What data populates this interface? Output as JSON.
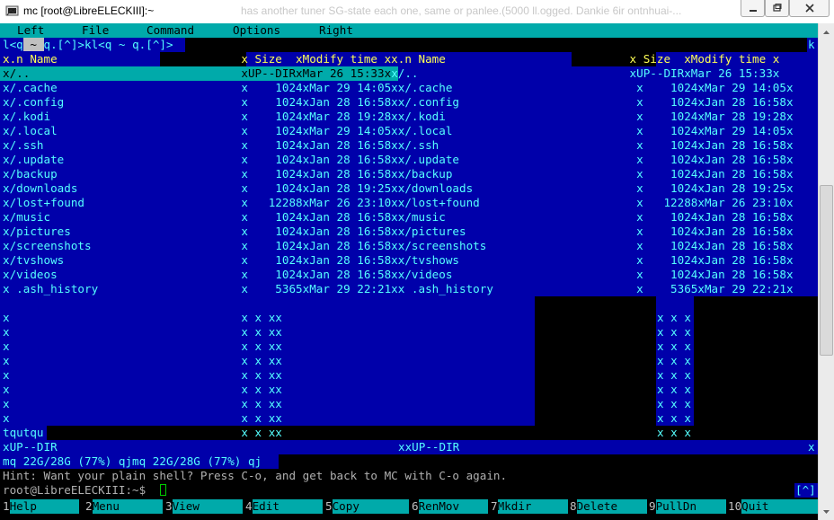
{
  "window": {
    "title": "mc [root@LibreELECKIII]:~",
    "ghost_text": "has another tuner SG-state each one, same or panlee.(5000 ll.ogged. Dankie 6ir ontnhuai-..."
  },
  "menubar": {
    "items": [
      {
        "label": "Left"
      },
      {
        "label": "File"
      },
      {
        "label": "Command"
      },
      {
        "label": "Options"
      },
      {
        "label": "Right"
      }
    ]
  },
  "line1": {
    "prefix": "l<q",
    "tilde": " ~ ",
    "rest": "q.[^]>kl<q ~ q.[^]>",
    "right_k": "k"
  },
  "header": {
    "left": "x.n Name                           x Size  xModify time xx",
    "right": ".n Name                           x Size  xModify time x"
  },
  "updir_row": {
    "left": "x/..                               xUP--DIRxMar 26 15:33x",
    "right": "x/..                               xUP--DIRxMar 26 15:33x"
  },
  "files": [
    {
      "name": "/.cache",
      "size": "1024",
      "mtime": "Mar 29 14:05"
    },
    {
      "name": "/.config",
      "size": "1024",
      "mtime": "Jan 28 16:58"
    },
    {
      "name": "/.kodi",
      "size": "1024",
      "mtime": "Mar 28 19:28"
    },
    {
      "name": "/.local",
      "size": "1024",
      "mtime": "Mar 29 14:05"
    },
    {
      "name": "/.ssh",
      "size": "1024",
      "mtime": "Jan 28 16:58"
    },
    {
      "name": "/.update",
      "size": "1024",
      "mtime": "Jan 28 16:58"
    },
    {
      "name": "/backup",
      "size": "1024",
      "mtime": "Jan 28 16:58"
    },
    {
      "name": "/downloads",
      "size": "1024",
      "mtime": "Jan 28 19:25"
    },
    {
      "name": "/lost+found",
      "size": "12288",
      "mtime": "Mar 26 23:10"
    },
    {
      "name": "/music",
      "size": "1024",
      "mtime": "Jan 28 16:58"
    },
    {
      "name": "/pictures",
      "size": "1024",
      "mtime": "Jan 28 16:58"
    },
    {
      "name": "/screenshots",
      "size": "1024",
      "mtime": "Jan 28 16:58"
    },
    {
      "name": "/tvshows",
      "size": "1024",
      "mtime": "Jan 28 16:58"
    },
    {
      "name": "/videos",
      "size": "1024",
      "mtime": "Jan 28 16:58"
    },
    {
      "name": " .ash_history",
      "size": "5365",
      "mtime": "Mar 29 22:21"
    }
  ],
  "empty_rows": {
    "count": 9,
    "left": "x                                  x x xx",
    "right": "x x x"
  },
  "tqutqu": "tqutqu",
  "mini_status": {
    "left": "xUP--DIR",
    "right": "xxUP--DIR",
    "end": "x"
  },
  "disk_line": "mq 22G/28G (77%) qjmq 22G/28G (77%) qj",
  "hint": "Hint: Want your plain shell? Press C-o, and get back to MC with C-o again.",
  "prompt": {
    "text": "root@LibreELECKIII:~$ ",
    "indicator": "[^]"
  },
  "fkeys": [
    {
      "num": "1",
      "label": "Help"
    },
    {
      "num": "2",
      "label": "Menu"
    },
    {
      "num": "3",
      "label": "View"
    },
    {
      "num": "4",
      "label": "Edit"
    },
    {
      "num": "5",
      "label": "Copy"
    },
    {
      "num": "6",
      "label": "RenMov"
    },
    {
      "num": "7",
      "label": "Mkdir"
    },
    {
      "num": "8",
      "label": "Delete"
    },
    {
      "num": "9",
      "label": "PullDn"
    },
    {
      "num": "10",
      "label": "Quit"
    }
  ],
  "colors": {
    "panel": "#0000aa",
    "cyan": "#00aaaa",
    "text": "#55ffff",
    "terminal_bg": "#000000"
  }
}
